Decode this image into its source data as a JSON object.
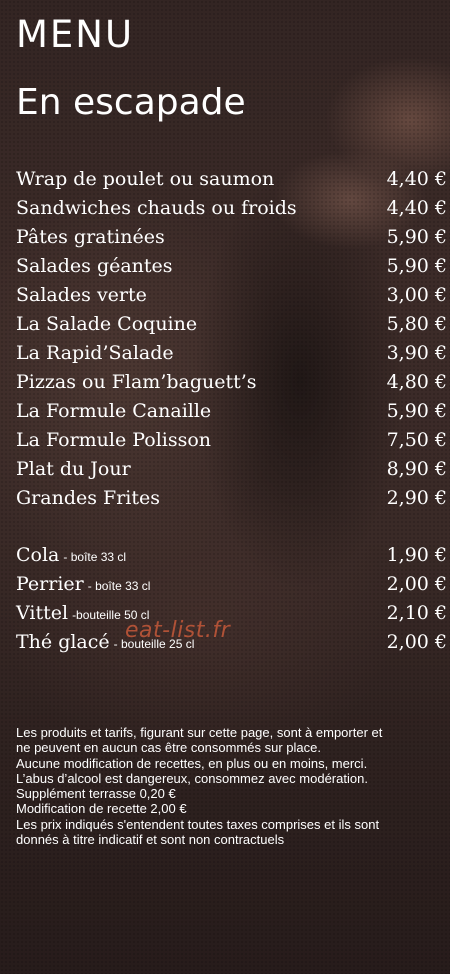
{
  "header": {
    "menu_label": "MENU",
    "section_title": "En escapade"
  },
  "items": [
    {
      "name": "Wrap de poulet ou saumon",
      "price": "4,40 €"
    },
    {
      "name": "Sandwiches chauds ou froids",
      "price": "4,40 €"
    },
    {
      "name": "Pâtes gratinées",
      "price": "5,90 €"
    },
    {
      "name": "Salades géantes",
      "price": "5,90 €"
    },
    {
      "name": "Salades verte",
      "price": "3,00 €"
    },
    {
      "name": "La Salade Coquine",
      "price": "5,80 €"
    },
    {
      "name": "La Rapid’Salade",
      "price": "3,90 €"
    },
    {
      "name": "Pizzas ou Flam’baguett’s",
      "price": "4,80 €"
    },
    {
      "name": "La Formule Canaille",
      "price": "5,90 €"
    },
    {
      "name": "La Formule Polisson",
      "price": "7,50 €"
    },
    {
      "name": "Plat du Jour",
      "price": "8,90 €"
    },
    {
      "name": "Grandes Frites",
      "price": "2,90 €"
    }
  ],
  "drinks": [
    {
      "name": "Cola",
      "note": "- boîte 33 cl",
      "price": "1,90 €"
    },
    {
      "name": "Perrier",
      "note": "- boîte 33 cl",
      "price": "2,00 €"
    },
    {
      "name": "Vittel",
      "note": "-bouteille 50 cl",
      "price": "2,10 €"
    },
    {
      "name": "Thé glacé",
      "note": "- bouteille 25 cl",
      "price": "2,00 €"
    }
  ],
  "watermark": "eat-list.fr",
  "disclaimer": [
    "Les produits et tarifs, figurant sur cette page, sont à emporter et",
    "ne peuvent en aucun cas être consommés sur place.",
    "Aucune modification de recettes, en plus ou en moins, merci.",
    "L’abus d’alcool est dangereux, consommez avec modération.",
    "Supplément terrasse 0,20 €",
    "Modification de recette 2,00 €",
    "Les prix indiqués s'entendent toutes taxes comprises et ils sont",
    "donnés à titre indicatif et sont non contractuels"
  ],
  "colors": {
    "text": "#ffffff",
    "background": "#2f2220",
    "watermark": "#d75f3c"
  }
}
